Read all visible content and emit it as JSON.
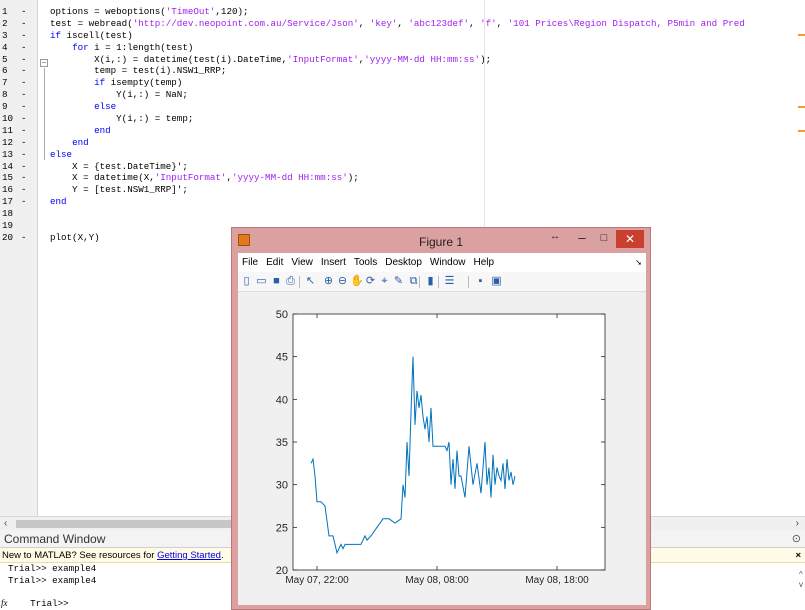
{
  "editor": {
    "lines": [
      {
        "n": "1",
        "dash": "-",
        "parts": [
          [
            "",
            "options = weboptions("
          ],
          [
            "str",
            "'TimeOut'"
          ],
          [
            "",
            ",120);"
          ]
        ]
      },
      {
        "n": "2",
        "dash": "-",
        "parts": [
          [
            "",
            "test = webread("
          ],
          [
            "str",
            "'http://dev.neopoint.com.au/Service/Json'"
          ],
          [
            "",
            ", "
          ],
          [
            "str",
            "'key'"
          ],
          [
            "",
            ", "
          ],
          [
            "str",
            "'abc123def'"
          ],
          [
            "",
            ", "
          ],
          [
            "str",
            "'f'"
          ],
          [
            "",
            ", "
          ],
          [
            "str",
            "'101 Prices\\Region Dispatch, P5min and Pred"
          ]
        ]
      },
      {
        "n": "3",
        "dash": "-",
        "parts": [
          [
            "kw",
            "if"
          ],
          [
            "",
            " iscell(test)"
          ]
        ]
      },
      {
        "n": "4",
        "dash": "-",
        "parts": [
          [
            "",
            "    "
          ],
          [
            "kw",
            "for"
          ],
          [
            "",
            " i = 1:length(test)"
          ]
        ]
      },
      {
        "n": "5",
        "dash": "-",
        "parts": [
          [
            "",
            "        X(i,:) = datetime(test(i).DateTime,"
          ],
          [
            "str",
            "'InputFormat'"
          ],
          [
            "",
            ","
          ],
          [
            "str",
            "'yyyy-MM-dd HH:mm:ss'"
          ],
          [
            "",
            ");"
          ]
        ]
      },
      {
        "n": "6",
        "dash": "-",
        "parts": [
          [
            "",
            "        temp = test(i).NSW1_RRP;"
          ]
        ]
      },
      {
        "n": "7",
        "dash": "-",
        "parts": [
          [
            "",
            "        "
          ],
          [
            "kw",
            "if"
          ],
          [
            "",
            " isempty(temp)"
          ]
        ]
      },
      {
        "n": "8",
        "dash": "-",
        "parts": [
          [
            "",
            "            Y(i,:) = NaN;"
          ]
        ]
      },
      {
        "n": "9",
        "dash": "-",
        "parts": [
          [
            "",
            "        "
          ],
          [
            "kw",
            "else"
          ]
        ]
      },
      {
        "n": "10",
        "dash": "-",
        "parts": [
          [
            "",
            "            Y(i,:) = temp;"
          ]
        ]
      },
      {
        "n": "11",
        "dash": "-",
        "parts": [
          [
            "",
            "        "
          ],
          [
            "kw",
            "end"
          ]
        ]
      },
      {
        "n": "12",
        "dash": "-",
        "parts": [
          [
            "",
            "    "
          ],
          [
            "kw",
            "end"
          ]
        ]
      },
      {
        "n": "13",
        "dash": "-",
        "parts": [
          [
            "kw",
            "else"
          ]
        ]
      },
      {
        "n": "14",
        "dash": "-",
        "parts": [
          [
            "",
            "    X = {test.DateTime}';"
          ]
        ]
      },
      {
        "n": "15",
        "dash": "-",
        "parts": [
          [
            "",
            "    X = datetime(X,"
          ],
          [
            "str",
            "'InputFormat'"
          ],
          [
            "",
            ","
          ],
          [
            "str",
            "'yyyy-MM-dd HH:mm:ss'"
          ],
          [
            "",
            ");"
          ]
        ]
      },
      {
        "n": "16",
        "dash": "-",
        "parts": [
          [
            "",
            "    Y = [test.NSW1_RRP]';"
          ]
        ]
      },
      {
        "n": "17",
        "dash": "-",
        "parts": [
          [
            "kw",
            "end"
          ]
        ]
      },
      {
        "n": "18",
        "dash": "",
        "parts": []
      },
      {
        "n": "19",
        "dash": "",
        "parts": []
      },
      {
        "n": "20",
        "dash": "-",
        "parts": [
          [
            "",
            "plot(X,Y)"
          ]
        ]
      }
    ]
  },
  "command_window": {
    "title": "Command Window",
    "banner_text": "New to MATLAB? See resources for ",
    "banner_link": "Getting Started",
    "banner_suffix": ".",
    "banner_close": "×",
    "options_icon": "⊙",
    "lines": [
      "Trial>> example4",
      "Trial>> example4",
      "Trial>> "
    ],
    "fx_label": "fx"
  },
  "figure": {
    "title": "Figure 1",
    "icon": "matlab-figure-icon",
    "menu": [
      "File",
      "Edit",
      "View",
      "Insert",
      "Tools",
      "Desktop",
      "Window",
      "Help"
    ],
    "toolbar": [
      {
        "name": "new-figure-icon",
        "glyph": "▯"
      },
      {
        "name": "open-file-icon",
        "glyph": "▭"
      },
      {
        "name": "save-icon",
        "glyph": "■"
      },
      {
        "name": "print-icon",
        "glyph": "⎙"
      },
      {
        "name": "edit-plot-icon",
        "glyph": "↖"
      },
      {
        "name": "zoom-in-icon",
        "glyph": "⊕"
      },
      {
        "name": "zoom-out-icon",
        "glyph": "⊖"
      },
      {
        "name": "pan-icon",
        "glyph": "✋"
      },
      {
        "name": "rotate-3d-icon",
        "glyph": "⟳"
      },
      {
        "name": "data-cursor-icon",
        "glyph": "⌖"
      },
      {
        "name": "brush-icon",
        "glyph": "✎"
      },
      {
        "name": "link-plot-icon",
        "glyph": "⧉"
      },
      {
        "name": "insert-colorbar-icon",
        "glyph": "▮"
      },
      {
        "name": "insert-legend-icon",
        "glyph": "☰"
      },
      {
        "name": "hide-plot-tools-icon",
        "glyph": "▪"
      },
      {
        "name": "show-plot-tools-icon",
        "glyph": "▣"
      }
    ]
  },
  "chart_data": {
    "type": "line",
    "title": "",
    "xlabel": "",
    "ylabel": "",
    "color": "#0072bd",
    "grid": false,
    "ylim": [
      20,
      50
    ],
    "yticks": [
      "20",
      "25",
      "30",
      "35",
      "40",
      "45",
      "50"
    ],
    "xlim": [
      "May 07, 20:00",
      "May 08, 22:00"
    ],
    "xticks": [
      "May 07, 22:00",
      "May 08, 08:00",
      "May 08, 18:00"
    ],
    "x": [
      "May 07, 21:30",
      "May 07, 21:40",
      "May 07, 21:50",
      "May 07, 22:00",
      "May 07, 22:20",
      "May 07, 22:40",
      "May 07, 23:00",
      "May 07, 23:20",
      "May 07, 23:40",
      "May 08, 00:00",
      "May 08, 00:10",
      "May 08, 00:20",
      "May 08, 00:40",
      "May 08, 01:00",
      "May 08, 01:20",
      "May 08, 01:40",
      "May 08, 02:00",
      "May 08, 02:10",
      "May 08, 02:30",
      "May 08, 03:00",
      "May 08, 03:30",
      "May 08, 04:00",
      "May 08, 04:30",
      "May 08, 05:00",
      "May 08, 05:10",
      "May 08, 05:20",
      "May 08, 05:30",
      "May 08, 05:40",
      "May 08, 05:50",
      "May 08, 06:00",
      "May 08, 06:10",
      "May 08, 06:20",
      "May 08, 06:30",
      "May 08, 06:40",
      "May 08, 06:50",
      "May 08, 07:00",
      "May 08, 07:10",
      "May 08, 07:20",
      "May 08, 07:30",
      "May 08, 07:40",
      "May 08, 07:50",
      "May 08, 08:00",
      "May 08, 08:10",
      "May 08, 08:20",
      "May 08, 08:30",
      "May 08, 08:40",
      "May 08, 08:50",
      "May 08, 09:00",
      "May 08, 09:10",
      "May 08, 09:20",
      "May 08, 09:30",
      "May 08, 09:40",
      "May 08, 09:50",
      "May 08, 10:00",
      "May 08, 10:20",
      "May 08, 10:40",
      "May 08, 11:00",
      "May 08, 11:20",
      "May 08, 11:40",
      "May 08, 12:00",
      "May 08, 12:10",
      "May 08, 12:20",
      "May 08, 12:30",
      "May 08, 12:40",
      "May 08, 12:50",
      "May 08, 13:00",
      "May 08, 13:10",
      "May 08, 13:20",
      "May 08, 13:30",
      "May 08, 13:40",
      "May 08, 13:50",
      "May 08, 14:00",
      "May 08, 14:10",
      "May 08, 14:20",
      "May 08, 14:30"
    ],
    "values": [
      32.5,
      33,
      31,
      28,
      28,
      27.5,
      24,
      24,
      22,
      23,
      22.5,
      23,
      23,
      23,
      23,
      23,
      24,
      23.5,
      24,
      25,
      26,
      26,
      25.5,
      26,
      30,
      28.5,
      35,
      31,
      38.5,
      45,
      37,
      41,
      39,
      40.5,
      38,
      36.5,
      38,
      35,
      39,
      34.5,
      34.5,
      34.5,
      34.5,
      34.5,
      34.5,
      34.5,
      34,
      35,
      30,
      33,
      29.5,
      34,
      31,
      31,
      28.5,
      34.5,
      30,
      32.5,
      29,
      35,
      30,
      32,
      28.5,
      33.5,
      30,
      32,
      31,
      30.5,
      32.5,
      29.5,
      33,
      30.5,
      31.5,
      30,
      31
    ]
  }
}
